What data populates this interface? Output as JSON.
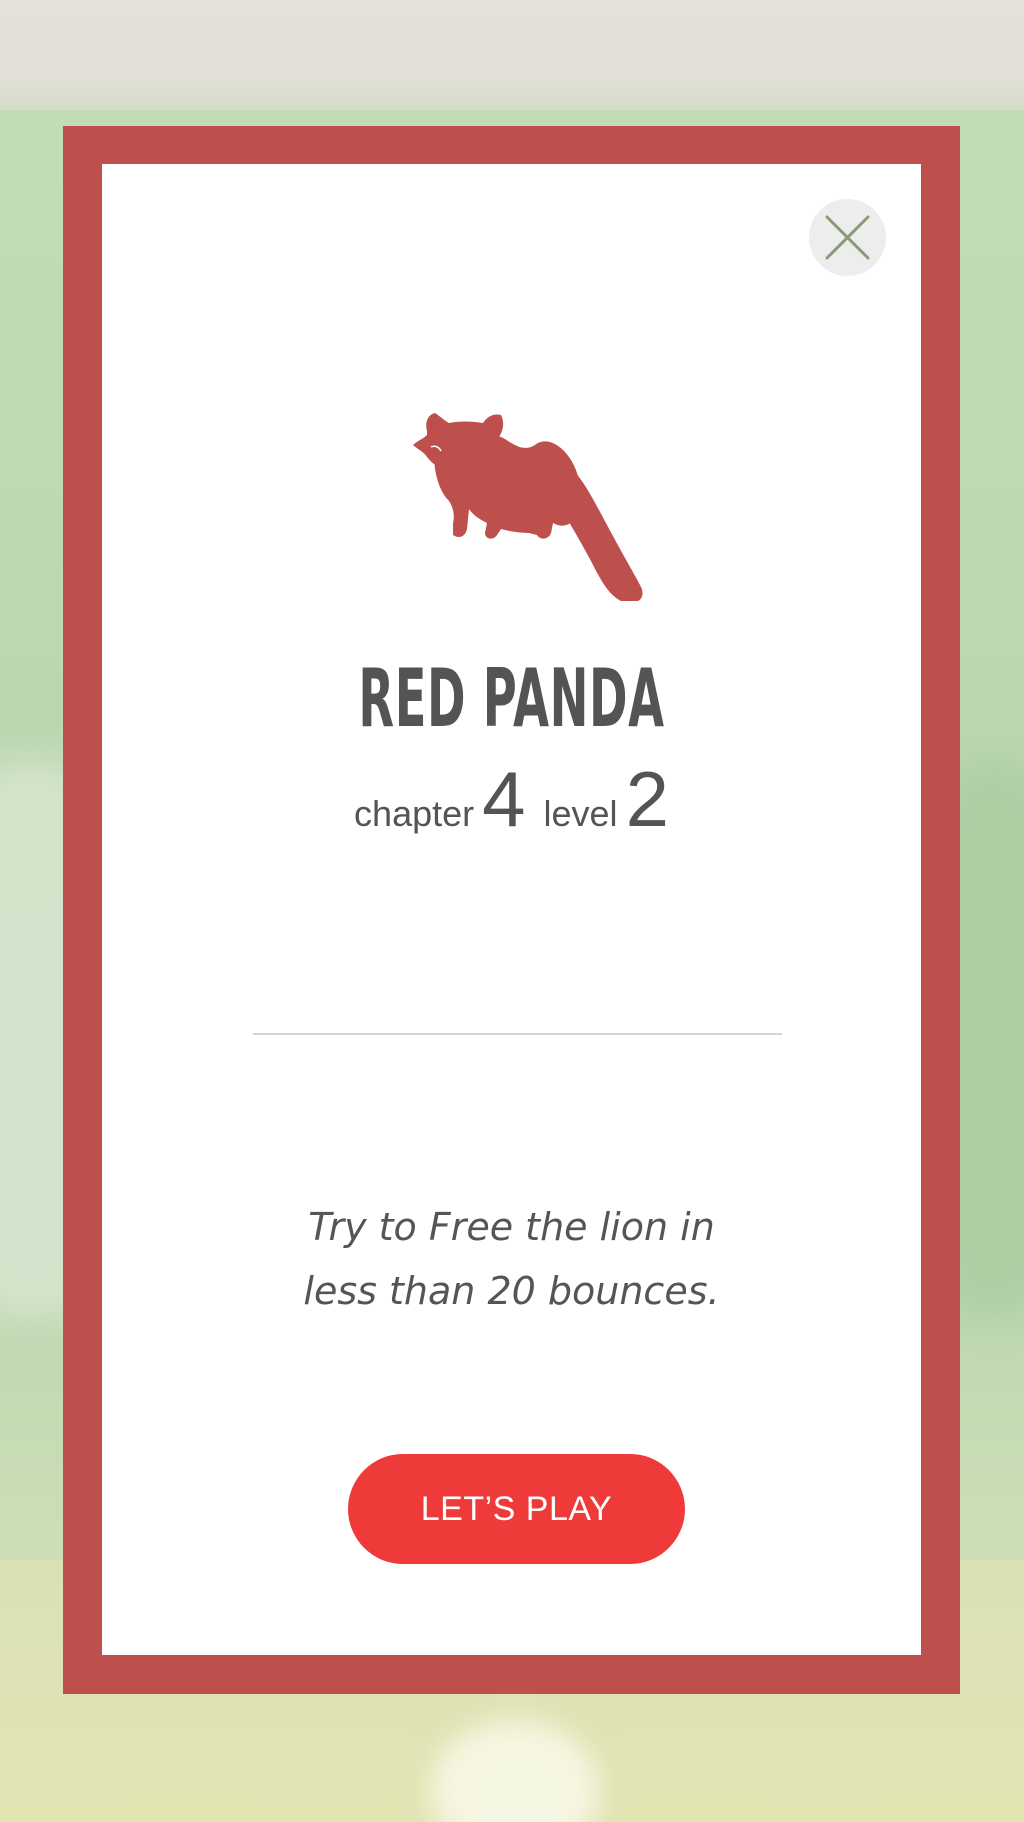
{
  "dialog": {
    "animal_name": "RED PANDA",
    "animal_icon": "red-panda-silhouette",
    "chapter_label": "chapter",
    "chapter_number": "4",
    "level_label": "level",
    "level_number": "2",
    "mission_line_1": "Try to Free the lion in",
    "mission_line_2": "less than 20 bounces.",
    "play_button_label": "LET’S PLAY",
    "close_icon": "close-icon"
  },
  "colors": {
    "frame": "#bd4f4d",
    "card": "#ffffff",
    "animal_icon": "#bd4f4d",
    "text": "#545454",
    "play_button": "#ef3a3a",
    "close_button_bg": "#ededed",
    "close_x": "#8a9a74"
  }
}
